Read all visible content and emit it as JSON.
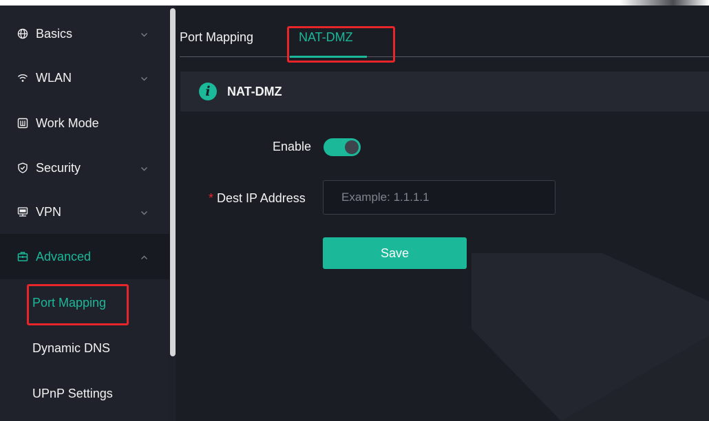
{
  "sidebar": {
    "items": [
      {
        "label": "Basics",
        "icon": "globe-icon"
      },
      {
        "label": "WLAN",
        "icon": "wifi-icon"
      },
      {
        "label": "Work Mode",
        "icon": "work-mode-icon"
      },
      {
        "label": "Security",
        "icon": "shield-icon"
      },
      {
        "label": "VPN",
        "icon": "vpn-icon"
      },
      {
        "label": "Advanced",
        "icon": "toolbox-icon"
      }
    ],
    "advanced_sub_items": [
      {
        "label": "Port Mapping"
      },
      {
        "label": "Dynamic DNS"
      },
      {
        "label": "UPnP Settings"
      }
    ]
  },
  "tabs": [
    {
      "label": "Port Mapping"
    },
    {
      "label": "NAT-DMZ"
    }
  ],
  "section": {
    "title": "NAT-DMZ",
    "icon": "info-icon"
  },
  "form": {
    "enable_label": "Enable",
    "enable_state": true,
    "required_mark": "*",
    "dest_ip_label": "Dest IP Address",
    "dest_ip_value": "",
    "dest_ip_placeholder": "Example: 1.1.1.1",
    "save_label": "Save"
  },
  "colors": {
    "accent": "#1bb89a",
    "highlight_box": "#e8262a",
    "background": "#1a1d24"
  }
}
